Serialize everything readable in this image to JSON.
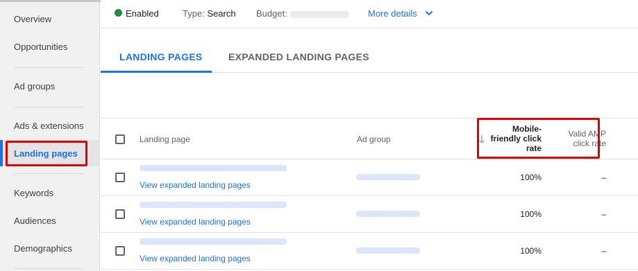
{
  "sidebar": {
    "items": [
      {
        "label": "Overview"
      },
      {
        "label": "Opportunities"
      },
      {
        "label": "Ad groups"
      },
      {
        "label": "Ads & extensions"
      },
      {
        "label": "Landing pages"
      },
      {
        "label": "Keywords"
      },
      {
        "label": "Audiences"
      },
      {
        "label": "Demographics"
      }
    ],
    "active": "Landing pages"
  },
  "status": {
    "state": "Enabled",
    "type_label": "Type:",
    "type_value": "Search",
    "budget_label": "Budget:",
    "more_details": "More details",
    "colors": {
      "enabled_dot": "#1e8e3e",
      "link": "#1a73e8"
    }
  },
  "tabs": [
    {
      "label": "LANDING PAGES",
      "active": true
    },
    {
      "label": "EXPANDED LANDING PAGES",
      "active": false
    }
  ],
  "table": {
    "columns": {
      "landing_page": "Landing page",
      "ad_group": "Ad group",
      "mobile_friendly": "Mobile-friendly click rate",
      "mobile_friendly_lines": [
        "Mobile-",
        "friendly click",
        "rate"
      ],
      "valid_amp": "Valid AMP click rate",
      "valid_amp_lines": [
        "Valid AMP",
        "click rate"
      ]
    },
    "sort_column": "mobile_friendly",
    "sort_direction": "descending",
    "rows": [
      {
        "expand_link": "View expanded landing pages",
        "mobile_friendly": "100%",
        "valid_amp": "–"
      },
      {
        "expand_link": "View expanded landing pages",
        "mobile_friendly": "100%",
        "valid_amp": "–"
      },
      {
        "expand_link": "View expanded landing pages",
        "mobile_friendly": "100%",
        "valid_amp": "–"
      }
    ]
  },
  "highlight_color": "#e00000"
}
